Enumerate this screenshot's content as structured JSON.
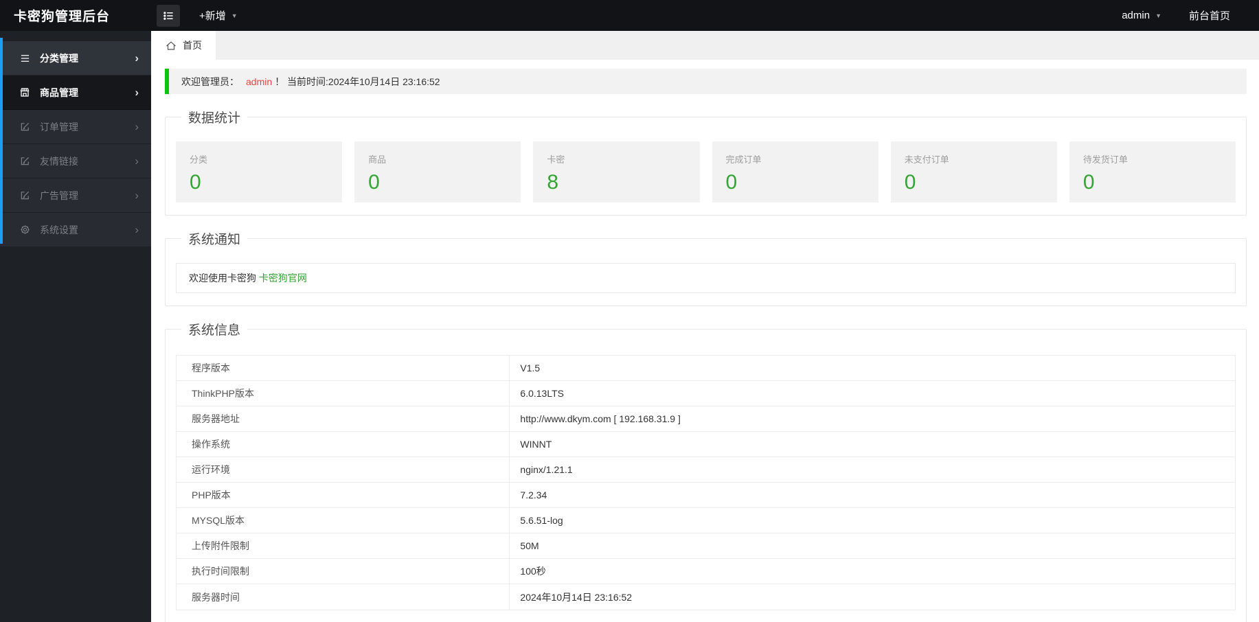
{
  "header": {
    "title": "卡密狗管理后台",
    "add_button": "+新增",
    "user": "admin",
    "frontend_link": "前台首页"
  },
  "sidebar": {
    "items": [
      {
        "label": "分类管理",
        "icon": "list-icon",
        "state": "hover"
      },
      {
        "label": "商品管理",
        "icon": "shop-icon",
        "state": "active"
      },
      {
        "label": "订单管理",
        "icon": "edit-icon",
        "state": "normal"
      },
      {
        "label": "友情链接",
        "icon": "edit-icon",
        "state": "normal"
      },
      {
        "label": "广告管理",
        "icon": "edit-icon",
        "state": "normal"
      },
      {
        "label": "系统设置",
        "icon": "gear-icon",
        "state": "normal"
      }
    ]
  },
  "tabs": {
    "home": "首页"
  },
  "welcome": {
    "prefix": "欢迎管理员：",
    "username": "admin",
    "suffix": "！ 当前时间:2024年10月14日 23:16:52"
  },
  "stats": {
    "legend": "数据统计",
    "cards": [
      {
        "label": "分类",
        "value": "0"
      },
      {
        "label": "商品",
        "value": "0"
      },
      {
        "label": "卡密",
        "value": "8"
      },
      {
        "label": "完成订单",
        "value": "0"
      },
      {
        "label": "未支付订单",
        "value": "0"
      },
      {
        "label": "待发货订单",
        "value": "0"
      }
    ]
  },
  "notice": {
    "legend": "系统通知",
    "text": "欢迎使用卡密狗 ",
    "link": "卡密狗官网"
  },
  "sysinfo": {
    "legend": "系统信息",
    "rows": [
      {
        "label": "程序版本",
        "value": "V1.5"
      },
      {
        "label": "ThinkPHP版本",
        "value": "6.0.13LTS"
      },
      {
        "label": "服务器地址",
        "value": "http://www.dkym.com [ 192.168.31.9 ]"
      },
      {
        "label": "操作系统",
        "value": "WINNT"
      },
      {
        "label": "运行环境",
        "value": "nginx/1.21.1"
      },
      {
        "label": "PHP版本",
        "value": "7.2.34"
      },
      {
        "label": "MYSQL版本",
        "value": "5.6.51-log"
      },
      {
        "label": "上传附件限制",
        "value": "50M"
      },
      {
        "label": "执行时间限制",
        "value": "100秒"
      },
      {
        "label": "服务器时间",
        "value": "2024年10月14日 23:16:52"
      }
    ]
  },
  "colors": {
    "accent_blue": "#1f9df5",
    "alert_green": "#0fc40f",
    "number_green": "#33a533",
    "admin_red": "#f53f3f"
  }
}
